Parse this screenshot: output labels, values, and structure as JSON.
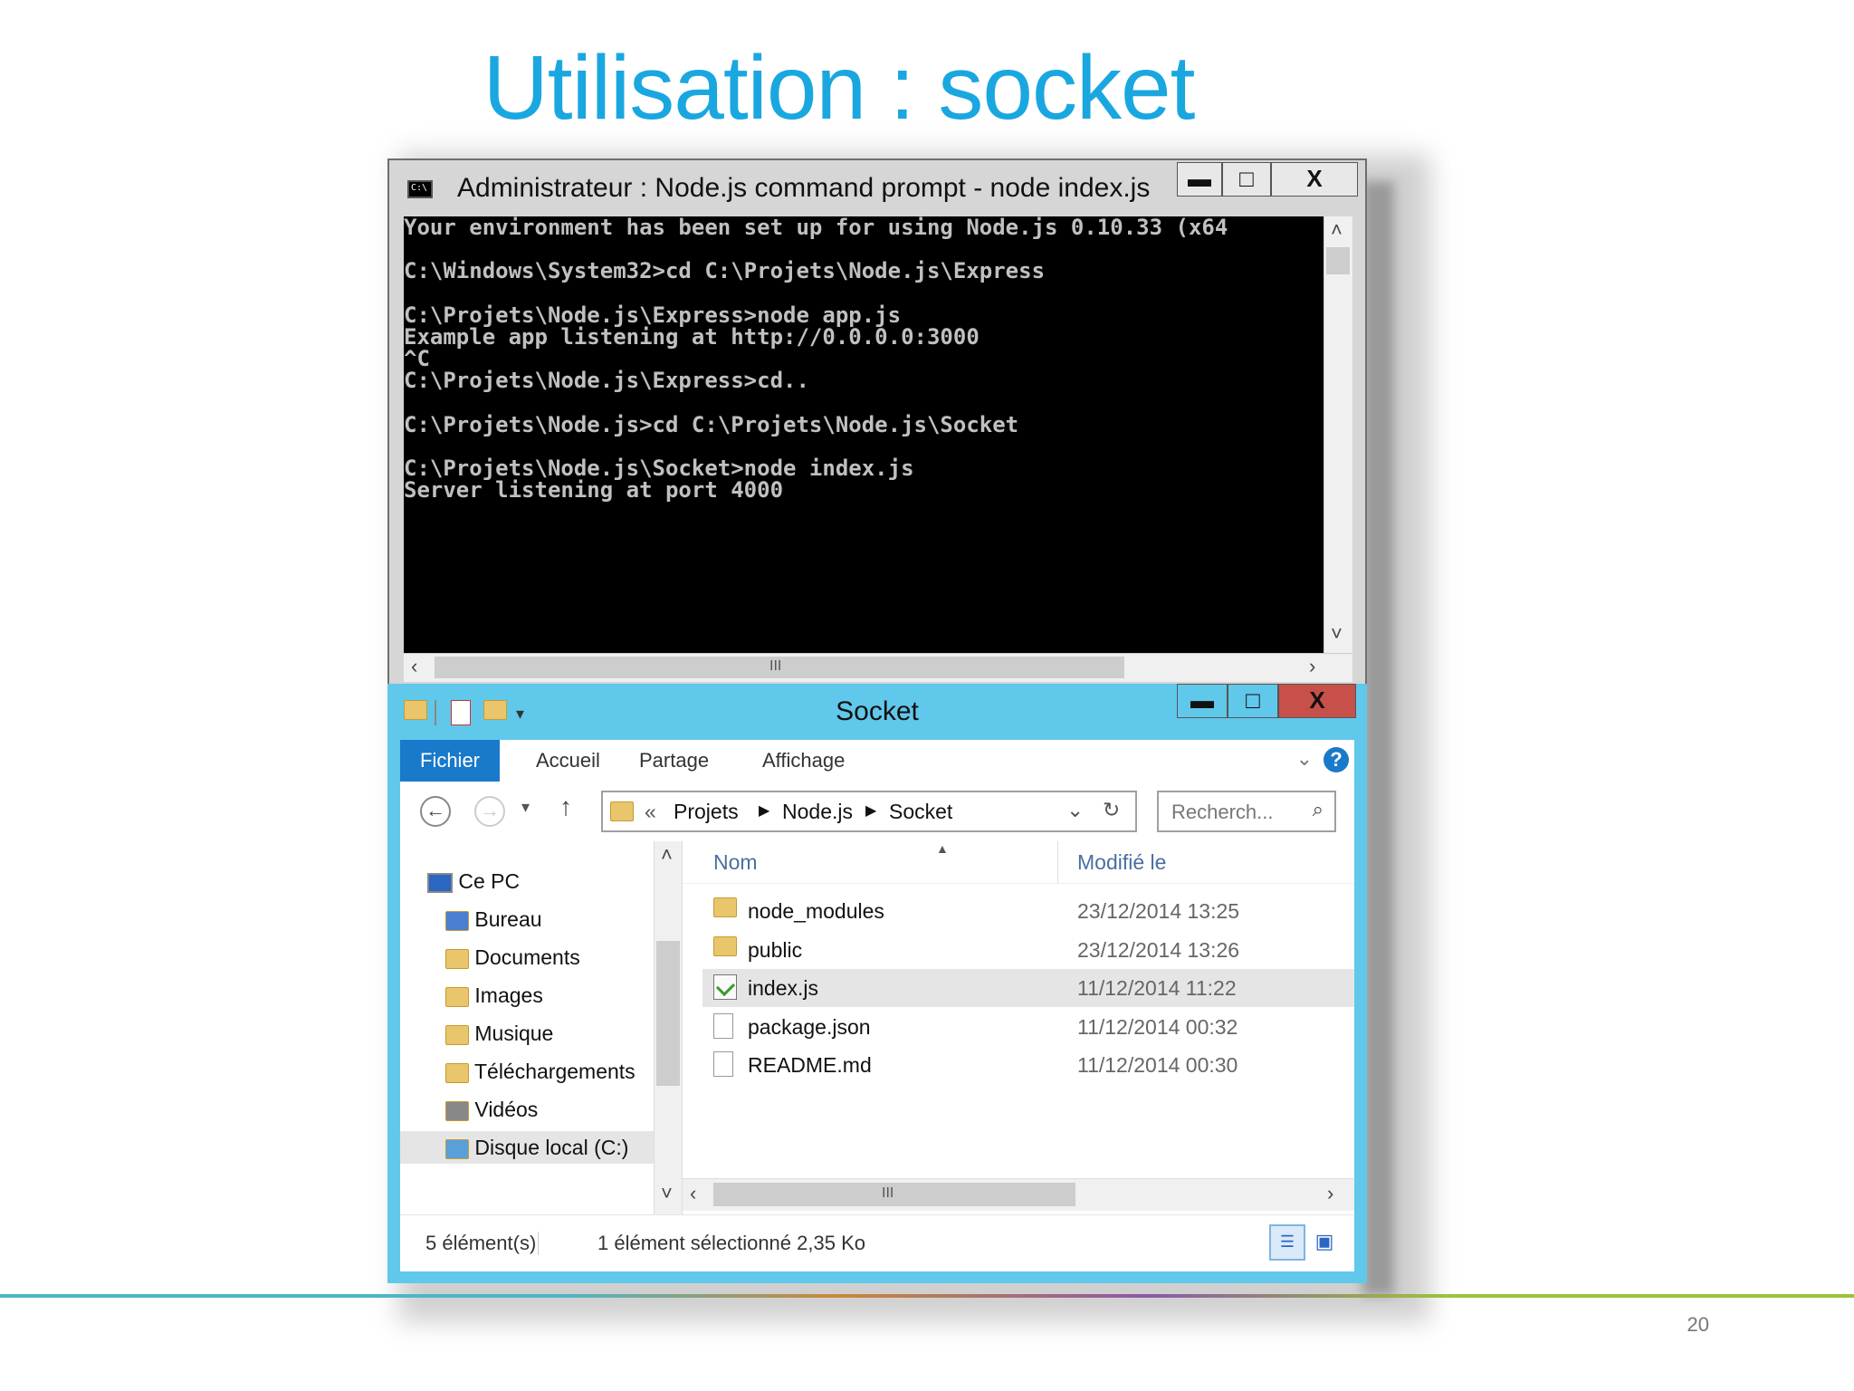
{
  "slide": {
    "title": "Utilisation : socket",
    "page_number": "20"
  },
  "cmd_window": {
    "title": "Administrateur : Node.js command prompt - node  index.js",
    "minimize": "▬",
    "maximize": "□",
    "close": "X",
    "lines": [
      "Your environment has been set up for using Node.js 0.10.33 (x64",
      "",
      "C:\\Windows\\System32>cd C:\\Projets\\Node.js\\Express",
      "",
      "C:\\Projets\\Node.js\\Express>node app.js",
      "Example app listening at http://0.0.0.0:3000",
      "^C",
      "C:\\Projets\\Node.js\\Express>cd..",
      "",
      "C:\\Projets\\Node.js>cd C:\\Projets\\Node.js\\Socket",
      "",
      "C:\\Projets\\Node.js\\Socket>node index.js",
      "Server listening at port 4000"
    ]
  },
  "explorer": {
    "title": "Socket",
    "minimize": "▬",
    "maximize": "□",
    "close": "X",
    "tabs": {
      "file": "Fichier",
      "home": "Accueil",
      "share": "Partage",
      "view": "Affichage"
    },
    "help": "?",
    "breadcrumb": {
      "prefix": "«",
      "parts": [
        "Projets",
        "Node.js",
        "Socket"
      ]
    },
    "search_placeholder": "Recherch...",
    "nav_tree": {
      "root": "Ce PC",
      "items": [
        "Bureau",
        "Documents",
        "Images",
        "Musique",
        "Téléchargements",
        "Vidéos",
        "Disque local (C:)"
      ]
    },
    "columns": {
      "name": "Nom",
      "modified": "Modifié le"
    },
    "files": [
      {
        "name": "node_modules",
        "modified": "23/12/2014 13:25",
        "type": "folder"
      },
      {
        "name": "public",
        "modified": "23/12/2014 13:26",
        "type": "folder"
      },
      {
        "name": "index.js",
        "modified": "11/12/2014 11:22",
        "type": "js",
        "selected": true
      },
      {
        "name": "package.json",
        "modified": "11/12/2014 00:32",
        "type": "file"
      },
      {
        "name": "README.md",
        "modified": "11/12/2014 00:30",
        "type": "file"
      }
    ],
    "status": {
      "count": "5 élément(s)",
      "selection": "1 élément sélectionné  2,35 Ko"
    }
  }
}
